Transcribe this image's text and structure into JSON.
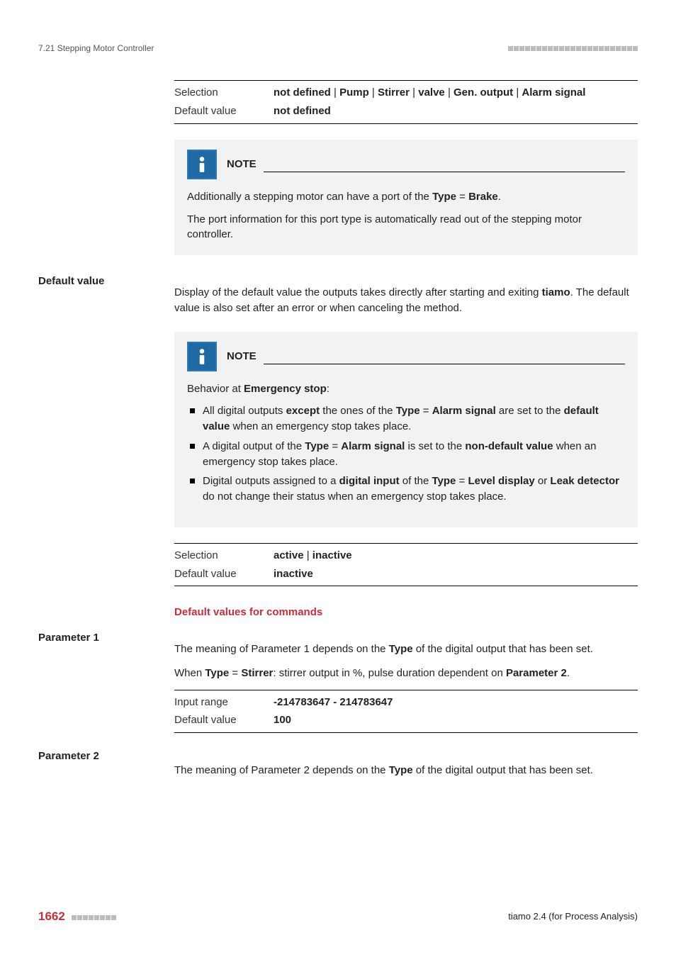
{
  "header": {
    "section": "7.21 Stepping Motor Controller"
  },
  "tables": {
    "type": {
      "selection_label": "Selection",
      "selection_value_parts": [
        "not defined",
        "Pump",
        "Stirrer",
        "valve",
        "Gen. output",
        "Alarm signal"
      ],
      "default_label": "Default value",
      "default_value": "not defined"
    },
    "default_value": {
      "selection_label": "Selection",
      "selection_value_parts": [
        "active",
        "inactive"
      ],
      "default_label": "Default value",
      "default_value": "inactive"
    },
    "param1": {
      "input_label": "Input range",
      "input_value": "-214783647 - 214783647",
      "default_label": "Default value",
      "default_value": "100"
    }
  },
  "notes": {
    "title": "NOTE",
    "note1": {
      "p1_pre": "Additionally a stepping motor can have a port of the ",
      "p1_b1": "Type",
      "p1_eq": " = ",
      "p1_b2": "Brake",
      "p1_post": ".",
      "p2": "The port information for this port type is automatically read out of the stepping motor controller."
    },
    "note2": {
      "intro_pre": "Behavior at ",
      "intro_b": "Emergency stop",
      "intro_post": ":",
      "b1_t1": "All digital outputs ",
      "b1_b1": "except",
      "b1_t2": " the ones of the ",
      "b1_b2": "Type",
      "b1_eq": " = ",
      "b1_b3": "Alarm signal",
      "b1_t3": " are set to the ",
      "b1_b4": "default value",
      "b1_t4": " when an emergency stop takes place.",
      "b2_t1": "A digital output of the ",
      "b2_b1": "Type",
      "b2_eq": " = ",
      "b2_b2": "Alarm signal",
      "b2_t2": " is set to the ",
      "b2_b3": "non-default value",
      "b2_t3": " when an emergency stop takes place.",
      "b3_t1": "Digital outputs assigned to a ",
      "b3_b1": "digital input",
      "b3_t2": " of the ",
      "b3_b2": "Type",
      "b3_eq": " = ",
      "b3_b3": "Level display",
      "b3_t3": " or ",
      "b3_b4": "Leak detector",
      "b3_t4": " do not change their status when an emergency stop takes place."
    }
  },
  "side": {
    "default_value": "Default value",
    "param1": "Parameter 1",
    "param2": "Parameter 2"
  },
  "body": {
    "default_value_p_pre": "Display of the default value the outputs takes directly after starting and exiting ",
    "default_value_p_b": "tiamo",
    "default_value_p_post": ". The default value is also set after an error or when canceling the method.",
    "section_heading": "Default values for commands",
    "param1_p1_pre": "The meaning of Parameter 1 depends on the ",
    "param1_p1_b": "Type",
    "param1_p1_post": " of the digital output that has been set.",
    "param1_p2_pre": "When ",
    "param1_p2_b1": "Type",
    "param1_p2_eq": " = ",
    "param1_p2_b2": "Stirrer",
    "param1_p2_mid": ": stirrer output in %, pulse duration dependent on ",
    "param1_p2_b3": "Parameter 2",
    "param1_p2_post": ".",
    "param2_p1_pre": "The meaning of Parameter 2 depends on the ",
    "param2_p1_b": "Type",
    "param2_p1_post": " of the digital output that has been set."
  },
  "footer": {
    "page": "1662",
    "right": "tiamo 2.4 (for Process Analysis)"
  }
}
